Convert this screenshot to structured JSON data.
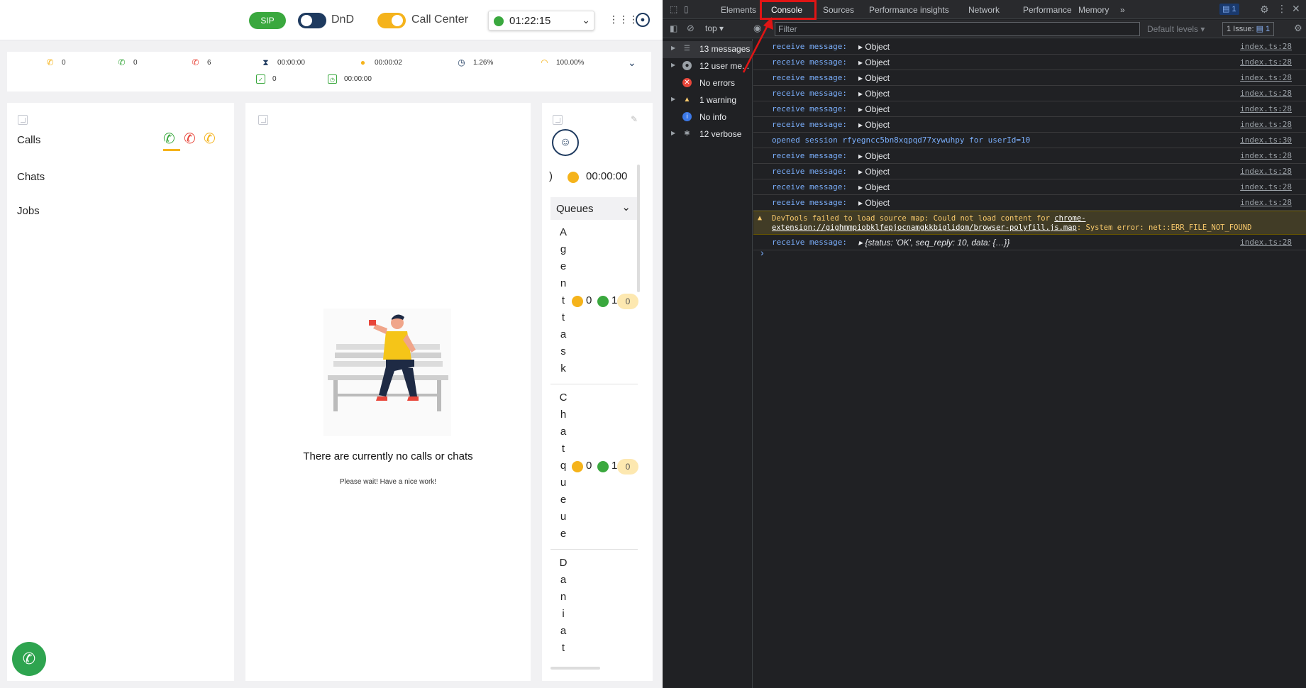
{
  "app": {
    "topbar": {
      "sip_label": "SIP",
      "dnd_label": "DnD",
      "call_center_label": "Call Center",
      "timer": "01:22:15"
    },
    "stats": {
      "row1": [
        "0",
        "0",
        "6",
        "00:00:00",
        "00:00:02",
        "1.26%",
        "100.00%"
      ],
      "row2": [
        "0",
        "00:00:00"
      ]
    },
    "nav": {
      "calls": "Calls",
      "chats": "Chats",
      "jobs": "Jobs"
    },
    "empty": {
      "title": "There are currently no calls or chats",
      "subtitle": "Please wait! Have a nice work!"
    },
    "queue_panel": {
      "paren": ")",
      "timer": "00:00:00",
      "queues_label": "Queues",
      "queues": [
        {
          "letters": [
            "A",
            "g",
            "e",
            "n",
            "t",
            "t",
            "a",
            "s",
            "k"
          ],
          "yellow": "0",
          "green": "1",
          "pill": "0"
        },
        {
          "letters": [
            "C",
            "h",
            "a",
            "t",
            "q",
            "u",
            "e",
            "u",
            "e"
          ],
          "yellow": "0",
          "green": "1",
          "pill": "0"
        },
        {
          "letters": [
            "D",
            "a",
            "n",
            "i",
            "a",
            "t"
          ]
        }
      ]
    },
    "colors": {
      "green": "#3aa83e",
      "yellow": "#f5b31b",
      "red": "#e8463a",
      "navy": "#1e3a5f"
    }
  },
  "devtools": {
    "tabs": [
      "Elements",
      "Console",
      "Sources",
      "Performance insights",
      "Network",
      "Performance",
      "Memory",
      "»"
    ],
    "badge_count": "1",
    "context": "top",
    "filter_placeholder": "Filter",
    "levels": "Default levels",
    "issues": "1 Issue:",
    "issues_count": "1",
    "sidebar": [
      {
        "label": "13 messages",
        "icon": "list-icon"
      },
      {
        "label": "12 user me...",
        "icon": "user-icon"
      },
      {
        "label": "No errors",
        "icon": "error-icon"
      },
      {
        "label": "1 warning",
        "icon": "warning-icon"
      },
      {
        "label": "No info",
        "icon": "info-icon"
      },
      {
        "label": "12 verbose",
        "icon": "bug-icon"
      }
    ],
    "logs": [
      {
        "msg": "receive message:",
        "obj": "Object",
        "src": "index.ts:28"
      },
      {
        "msg": "receive message:",
        "obj": "Object",
        "src": "index.ts:28"
      },
      {
        "msg": "receive message:",
        "obj": "Object",
        "src": "index.ts:28"
      },
      {
        "msg": "receive message:",
        "obj": "Object",
        "src": "index.ts:28"
      },
      {
        "msg": "receive message:",
        "obj": "Object",
        "src": "index.ts:28"
      },
      {
        "msg": "receive message:",
        "obj": "Object",
        "src": "index.ts:28"
      },
      {
        "msg": "opened session rfyegncc5bn8xqpqd77xywuhpy for userId=10",
        "obj": "",
        "src": "index.ts:30"
      },
      {
        "msg": "receive message:",
        "obj": "Object",
        "src": "index.ts:28"
      },
      {
        "msg": "receive message:",
        "obj": "Object",
        "src": "index.ts:28"
      },
      {
        "msg": "receive message:",
        "obj": "Object",
        "src": "index.ts:28"
      },
      {
        "msg": "receive message:",
        "obj": "Object",
        "src": "index.ts:28"
      }
    ],
    "warning": {
      "text1": "DevTools failed to load source map: Could not load content for ",
      "link": "chrome-extension://gighmmpiobklfepjocnamgkkbiglidom/browser-polyfill.js.map",
      "text2": ": System error: net::ERR_FILE_NOT_FOUND"
    },
    "last_log": {
      "msg": "receive message:",
      "obj": "{status: 'OK', seq_reply: 10, data: {…}}",
      "src": "index.ts:28"
    },
    "prompt": "›"
  }
}
